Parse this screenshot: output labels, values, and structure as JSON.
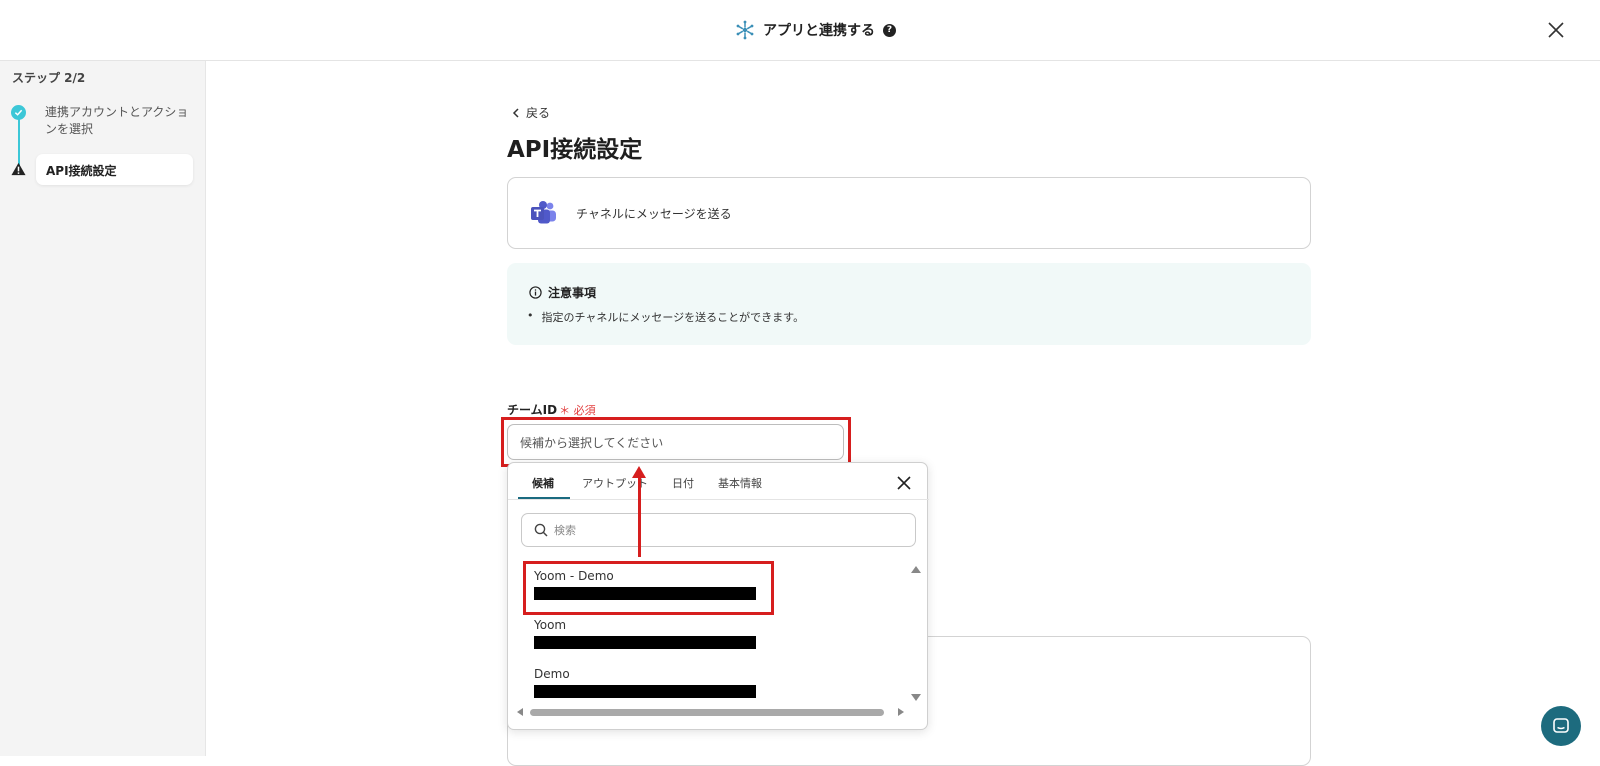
{
  "header": {
    "title": "アプリと連携する",
    "help_icon": "?"
  },
  "sidebar": {
    "step_label": "ステップ 2/2",
    "steps": [
      {
        "label": "連携アカウントとアクションを選択",
        "status": "done"
      },
      {
        "label": "API接続設定",
        "status": "warning",
        "active": true
      }
    ]
  },
  "main": {
    "back_label": "戻る",
    "page_title": "API接続設定",
    "action": {
      "icon": "teams-icon",
      "label": "チャネルにメッセージを送る"
    },
    "notice": {
      "title": "注意事項",
      "items": [
        "指定のチャネルにメッセージを送ることができます。"
      ]
    },
    "team_id": {
      "label": "チームID",
      "required_mark": "＊ 必須",
      "placeholder": "候補から選択してください"
    }
  },
  "popup": {
    "tabs": [
      "候補",
      "アウトプット",
      "日付",
      "基本情報"
    ],
    "active_tab": "候補",
    "search_placeholder": "検索",
    "options": [
      {
        "name": "Yoom - Demo",
        "highlighted": true
      },
      {
        "name": "Yoom"
      },
      {
        "name": "Demo"
      }
    ]
  },
  "colors": {
    "accent": "#3cc7d7",
    "highlight": "#d61e1e",
    "chat": "#1d6b7e"
  }
}
